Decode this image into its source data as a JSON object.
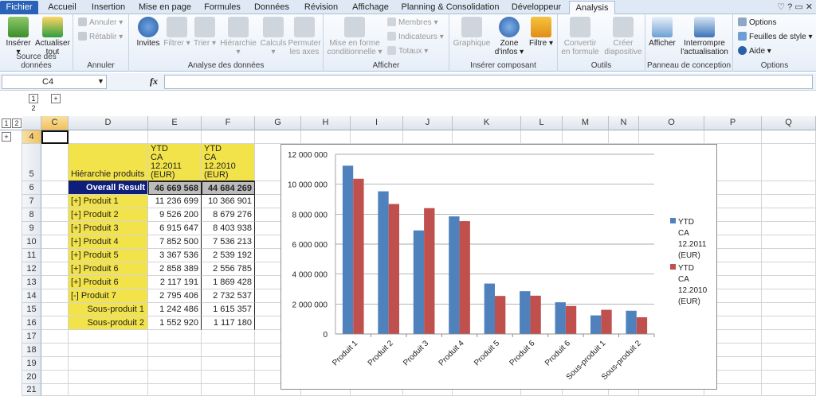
{
  "tabs": [
    "Fichier",
    "Accueil",
    "Insertion",
    "Mise en page",
    "Formules",
    "Données",
    "Révision",
    "Affichage",
    "Planning & Consolidation",
    "Développeur",
    "Analysis"
  ],
  "window_controls": "♡ ? ▭ ✕",
  "ribbon": {
    "groups": [
      {
        "label": "Source des données",
        "buttons": [
          "Insérer",
          "Actualiser tout"
        ]
      },
      {
        "label": "Annuler",
        "buttons": [
          "Annuler",
          "Rétablir"
        ]
      },
      {
        "label": "Analyse des données",
        "buttons": [
          "Invites",
          "Filtrer",
          "Trier",
          "Hiérarchie",
          "Calculs",
          "Permuter les axes"
        ]
      },
      {
        "label": "Afficher",
        "buttons": [
          "Mise en forme conditionnelle",
          "Membres",
          "Indicateurs",
          "Totaux"
        ]
      },
      {
        "label": "Insérer composant",
        "buttons": [
          "Graphique",
          "Zone d'infos",
          "Filtre"
        ]
      },
      {
        "label": "Outils",
        "buttons": [
          "Convertir en formule",
          "Créer diapositive"
        ]
      },
      {
        "label": "Panneau de conception",
        "buttons": [
          "Afficher",
          "Interrompre l'actualisation"
        ]
      },
      {
        "label": "Options",
        "buttons": [
          "Options",
          "Feuilles de style",
          "Aide"
        ]
      }
    ],
    "disabled": [
      "Annuler",
      "Rétablir",
      "Filtrer",
      "Trier",
      "Hiérarchie",
      "Calculs",
      "Permuter les axes",
      "Mise en forme conditionnelle",
      "Membres",
      "Indicateurs",
      "Totaux",
      "Graphique",
      "Convertir en formule",
      "Créer diapositive"
    ]
  },
  "formula_bar": {
    "name_box": "C4",
    "fx": "fx",
    "formula": ""
  },
  "outline": {
    "levels_col": [
      "1",
      "2"
    ],
    "levels_row": [
      "1",
      "2"
    ],
    "plus": "+"
  },
  "columns": [
    "C",
    "D",
    "E",
    "F",
    "G",
    "H",
    "I",
    "J",
    "K",
    "L",
    "M",
    "N",
    "O",
    "P",
    "Q"
  ],
  "rows": [
    "4",
    "5",
    "6",
    "7",
    "8",
    "9",
    "10",
    "11",
    "12",
    "13",
    "14",
    "15",
    "16",
    "17",
    "18",
    "19",
    "20",
    "21"
  ],
  "table": {
    "hier_label": "Hiérarchie produits",
    "col1_header": [
      "YTD",
      "CA",
      "12.2011",
      "(EUR)"
    ],
    "col2_header": [
      "YTD",
      "CA",
      "12.2010",
      "(EUR)"
    ],
    "overall": {
      "label": "Overall Result",
      "v1": "46 669 568",
      "v2": "44 684 269"
    },
    "rows": [
      {
        "label": "[+] Produit 1",
        "v1": "11 236 699",
        "v2": "10 366 901"
      },
      {
        "label": "[+] Produit 2",
        "v1": "9 526 200",
        "v2": "8 679 276"
      },
      {
        "label": "[+] Produit 3",
        "v1": "6 915 647",
        "v2": "8 403 938"
      },
      {
        "label": "[+] Produit 4",
        "v1": "7 852 500",
        "v2": "7 536 213"
      },
      {
        "label": "[+] Produit 5",
        "v1": "3 367 536",
        "v2": "2 539 192"
      },
      {
        "label": "[+] Produit 6",
        "v1": "2 858 389",
        "v2": "2 556 785"
      },
      {
        "label": "[+] Produit 6",
        "v1": "2 117 191",
        "v2": "1 869 428"
      },
      {
        "label": "[-] Produit 7",
        "v1": "2 795 406",
        "v2": "2 732 537"
      },
      {
        "label": "Sous-produit 1",
        "v1": "1 242 486",
        "v2": "1 615 357"
      },
      {
        "label": "Sous-produit 2",
        "v1": "1 552 920",
        "v2": "1 117 180"
      }
    ]
  },
  "chart_data": {
    "type": "bar",
    "categories": [
      "Produit 1",
      "Produit 2",
      "Produit 3",
      "Produit 4",
      "Produit 5",
      "Produit 6",
      "Produit 6",
      "Sous-produit 1",
      "Sous-produit 2"
    ],
    "series": [
      {
        "name": "YTD CA 12.2011 (EUR)",
        "color": "#4f81bd",
        "values": [
          11236699,
          9526200,
          6915647,
          7852500,
          3367536,
          2858389,
          2117191,
          1242486,
          1552920
        ]
      },
      {
        "name": "YTD CA 12.2010 (EUR)",
        "color": "#c0504d",
        "values": [
          10366901,
          8679276,
          8403938,
          7536213,
          2539192,
          2556785,
          1869428,
          1615357,
          1117180
        ]
      }
    ],
    "legend_lines": [
      [
        "YTD",
        "CA",
        "12.2011",
        "(EUR)"
      ],
      [
        "YTD",
        "CA",
        "12.2010",
        "(EUR)"
      ]
    ],
    "yticks": [
      "0",
      "2 000 000",
      "4 000 000",
      "6 000 000",
      "8 000 000",
      "10 000 000",
      "12 000 000"
    ],
    "ylim": [
      0,
      12000000
    ],
    "grid": true,
    "legend_position": "right"
  }
}
